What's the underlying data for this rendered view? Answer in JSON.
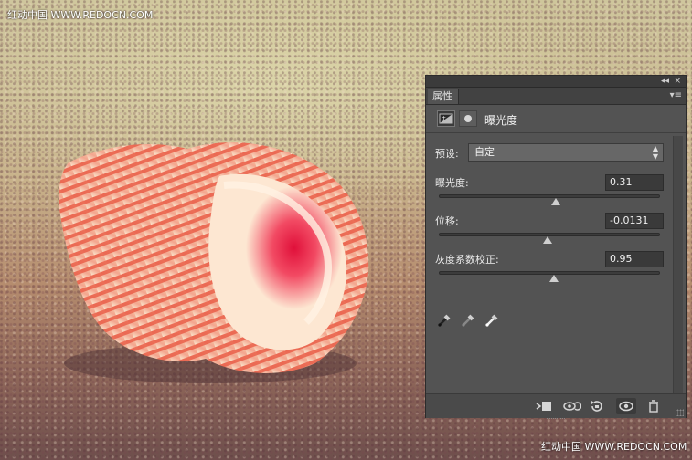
{
  "watermark_top": "红动中国 WWW.REDOCN.COM",
  "watermark_bottom": "红动中国 WWW.REDOCN.COM",
  "panel": {
    "collapse_glyph": "◂◂",
    "close_glyph": "×",
    "tab_label": "属性",
    "menu_glyph": "▾≡",
    "title": "曝光度",
    "adjustment_icon": "exposure-adjustment-icon",
    "mask_icon": "layer-mask-icon",
    "preset": {
      "label": "预设:",
      "value": "自定"
    },
    "sliders": [
      {
        "label": "曝光度:",
        "value": "0.31",
        "level": 0.53
      },
      {
        "label": "位移:",
        "value": "-0.0131",
        "level": 0.49
      },
      {
        "label": "灰度系数校正:",
        "value": "0.95",
        "level": 0.52
      }
    ],
    "eyedroppers": [
      "black-point-eyedropper-icon",
      "gray-point-eyedropper-icon",
      "white-point-eyedropper-icon"
    ],
    "bottom_icons": [
      "clip-to-layer-icon",
      "view-previous-state-icon",
      "reset-icon",
      "visibility-eye-icon",
      "trash-icon"
    ]
  },
  "colors": {
    "panel_bg": "#535353",
    "panel_dark": "#3a3a3a",
    "text": "#ececec"
  }
}
